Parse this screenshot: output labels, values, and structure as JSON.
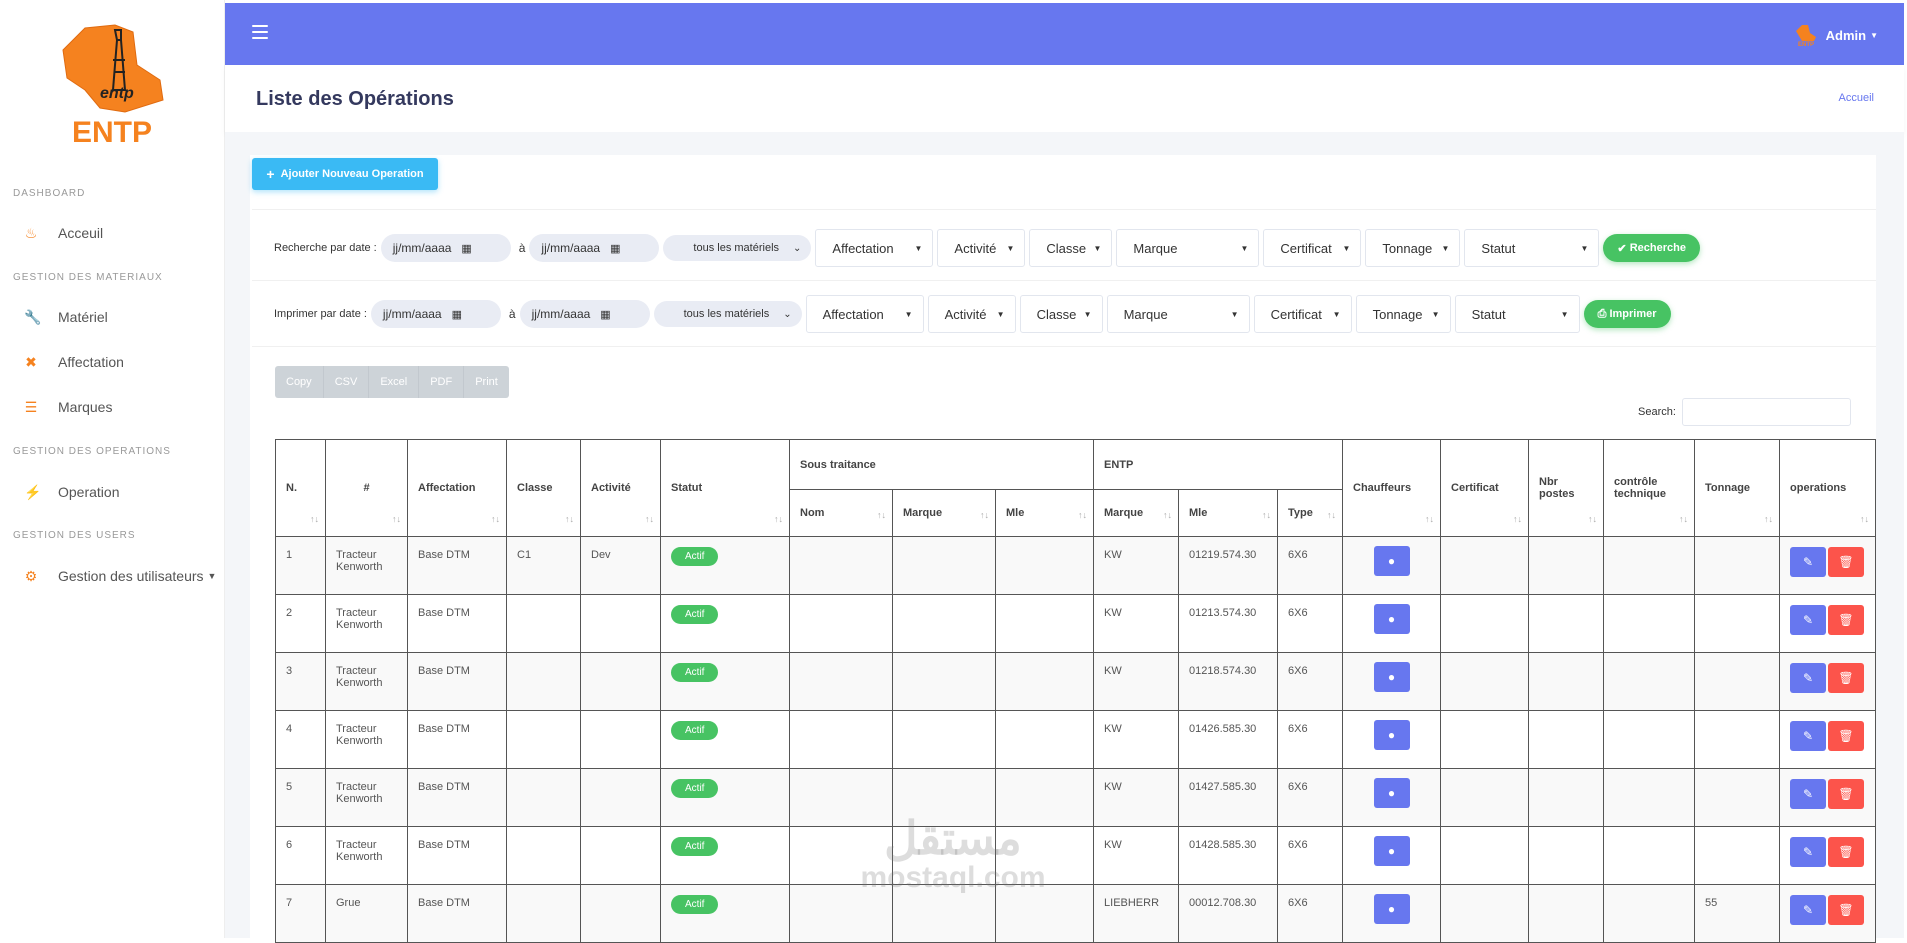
{
  "brand": {
    "logo_text": "ENTP",
    "accent": "#f5821f"
  },
  "sidebar": {
    "sections": [
      {
        "title": "DASHBOARD",
        "items": [
          {
            "label": "Acceuil",
            "icon": "fire-icon"
          }
        ]
      },
      {
        "title": "GESTION DES MATERIAUX",
        "items": [
          {
            "label": "Matériel",
            "icon": "wrench-icon"
          },
          {
            "label": "Affectation",
            "icon": "arrows-icon"
          },
          {
            "label": "Marques",
            "icon": "list-icon"
          }
        ]
      },
      {
        "title": "GESTION DES OPERATIONS",
        "items": [
          {
            "label": "Operation",
            "icon": "plug-icon"
          }
        ]
      },
      {
        "title": "GESTION DES USERS",
        "items": [
          {
            "label": "Gestion des utilisateurs",
            "icon": "cogs-icon"
          }
        ]
      }
    ]
  },
  "topbar": {
    "user": "Admin",
    "color": "#6777ef"
  },
  "header": {
    "title": "Liste des Opérations",
    "breadcrumb": "Accueil"
  },
  "actions": {
    "add_label": "Ajouter Nouveau Operation"
  },
  "search_row": {
    "label": "Recherche par date :",
    "date_from": "jj/mm/aaaa",
    "sep": "à",
    "date_to": "jj/mm/aaaa",
    "materiel": "tous les matériels",
    "filters": [
      "Affectation",
      "Activité",
      "Classe",
      "Marque",
      "Certificat",
      "Tonnage",
      "Statut"
    ],
    "button": "Recherche"
  },
  "print_row": {
    "label": "Imprimer par date :",
    "date_from": "jj/mm/aaaa",
    "sep": "à",
    "date_to": "jj/mm/aaaa",
    "materiel": "tous les matériels",
    "filters": [
      "Affectation",
      "Activité",
      "Classe",
      "Marque",
      "Certificat",
      "Tonnage",
      "Statut"
    ],
    "button": "Imprimer"
  },
  "export": [
    "Copy",
    "CSV",
    "Excel",
    "PDF",
    "Print"
  ],
  "search": {
    "label": "Search:"
  },
  "table": {
    "headers": {
      "n": "N.",
      "hash": "#",
      "affectation": "Affectation",
      "classe": "Classe",
      "activite": "Activité",
      "statut": "Statut",
      "sous_traitance": "Sous traitance",
      "entp": "ENTP",
      "st_nom": "Nom",
      "st_marque": "Marque",
      "st_mle": "Mle",
      "e_marque": "Marque",
      "e_mle": "Mle",
      "e_type": "Type",
      "chauffeurs": "Chauffeurs",
      "certificat": "Certificat",
      "nbr_postes": "Nbr postes",
      "controle": "contrôle technique",
      "tonnage": "Tonnage",
      "operations": "operations"
    },
    "rows": [
      {
        "n": "1",
        "name": "Tracteur Kenworth",
        "affectation": "Base DTM",
        "classe": "C1",
        "activite": "Dev",
        "statut": "Actif",
        "marque": "KW",
        "mle": "01219.574.30",
        "type": "6X6",
        "tonnage": ""
      },
      {
        "n": "2",
        "name": "Tracteur Kenworth",
        "affectation": "Base DTM",
        "classe": "",
        "activite": "",
        "statut": "Actif",
        "marque": "KW",
        "mle": "01213.574.30",
        "type": "6X6",
        "tonnage": ""
      },
      {
        "n": "3",
        "name": "Tracteur Kenworth",
        "affectation": "Base DTM",
        "classe": "",
        "activite": "",
        "statut": "Actif",
        "marque": "KW",
        "mle": "01218.574.30",
        "type": "6X6",
        "tonnage": ""
      },
      {
        "n": "4",
        "name": "Tracteur Kenworth",
        "affectation": "Base DTM",
        "classe": "",
        "activite": "",
        "statut": "Actif",
        "marque": "KW",
        "mle": "01426.585.30",
        "type": "6X6",
        "tonnage": ""
      },
      {
        "n": "5",
        "name": "Tracteur Kenworth",
        "affectation": "Base DTM",
        "classe": "",
        "activite": "",
        "statut": "Actif",
        "marque": "KW",
        "mle": "01427.585.30",
        "type": "6X6",
        "tonnage": ""
      },
      {
        "n": "6",
        "name": "Tracteur Kenworth",
        "affectation": "Base DTM",
        "classe": "",
        "activite": "",
        "statut": "Actif",
        "marque": "KW",
        "mle": "01428.585.30",
        "type": "6X6",
        "tonnage": ""
      },
      {
        "n": "7",
        "name": "Grue",
        "affectation": "Base DTM",
        "classe": "",
        "activite": "",
        "statut": "Actif",
        "marque": "LIEBHERR",
        "mle": "00012.708.30",
        "type": "6X6",
        "tonnage": "55"
      }
    ]
  },
  "watermark": {
    "ar": "مستقل",
    "en": "mostaql.com"
  }
}
